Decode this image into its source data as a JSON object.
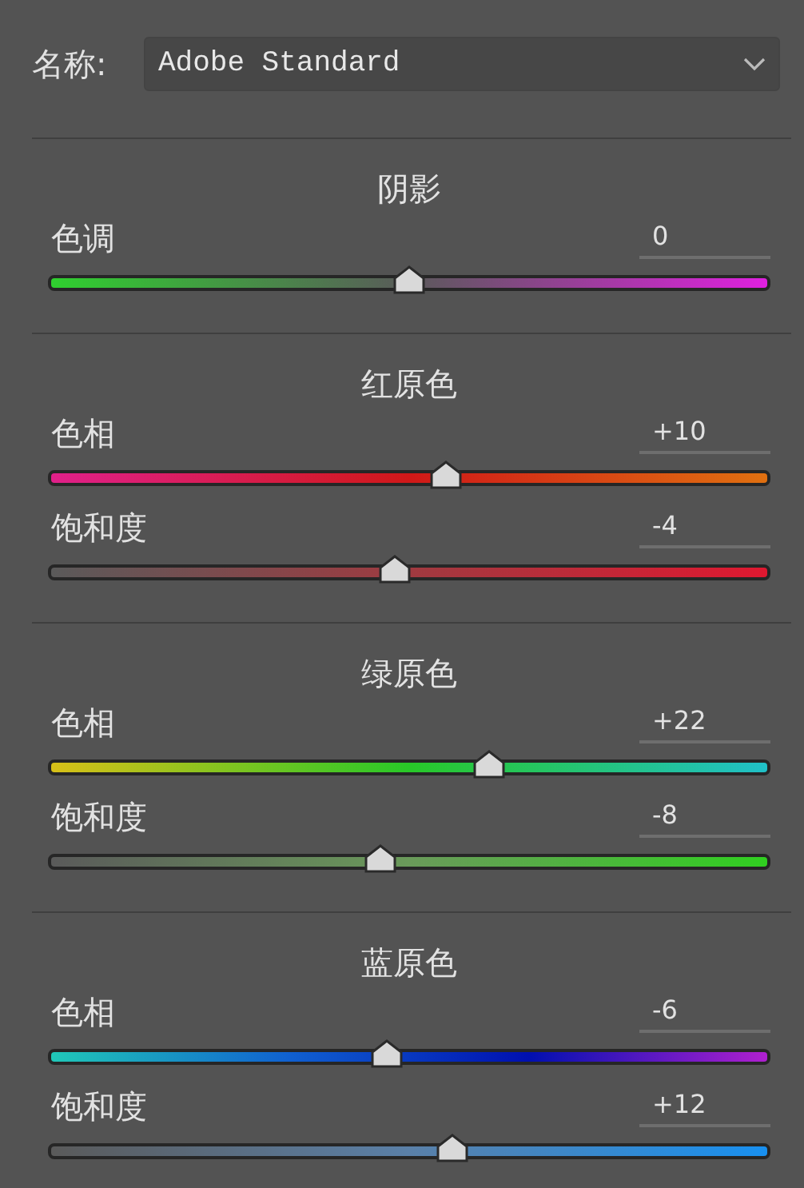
{
  "profile": {
    "label": "名称:",
    "value": "Adobe Standard"
  },
  "sections": [
    {
      "title": "阴影",
      "sliders": [
        {
          "kind": "tint",
          "label": "色调",
          "value": "0",
          "level": 0.5
        }
      ]
    },
    {
      "title": "红原色",
      "sliders": [
        {
          "kind": "red-hue",
          "label": "色相",
          "value": "+10",
          "level": 0.55
        },
        {
          "kind": "red-saturation",
          "label": "饱和度",
          "value": "-4",
          "level": 0.48
        }
      ]
    },
    {
      "title": "绿原色",
      "sliders": [
        {
          "kind": "green-hue",
          "label": "色相",
          "value": "+22",
          "level": 0.61
        },
        {
          "kind": "green-saturation",
          "label": "饱和度",
          "value": "-8",
          "level": 0.46
        }
      ]
    },
    {
      "title": "蓝原色",
      "sliders": [
        {
          "kind": "blue-hue",
          "label": "色相",
          "value": "-6",
          "level": 0.47
        },
        {
          "kind": "blue-saturation",
          "label": "饱和度",
          "value": "+12",
          "level": 0.56
        }
      ]
    }
  ]
}
